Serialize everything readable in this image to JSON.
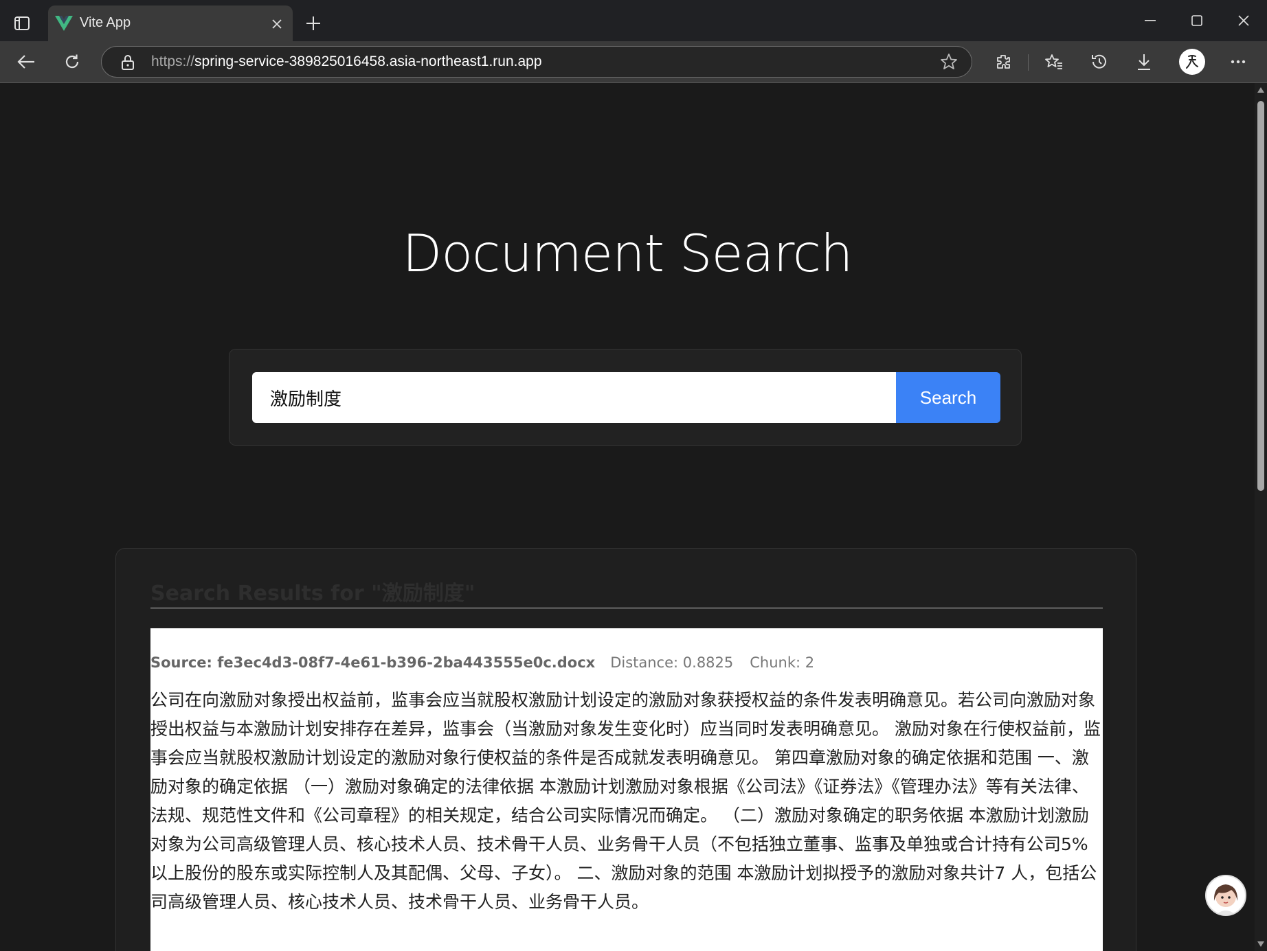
{
  "browser": {
    "tab_title": "Vite App",
    "url_protocol": "https://",
    "url_host": "spring-service-389825016458.asia-northeast1.run.app"
  },
  "page": {
    "title": "Document Search",
    "search": {
      "query": "激励制度",
      "button_label": "Search"
    },
    "results": {
      "heading": "Search Results for \"激励制度\"",
      "items": [
        {
          "source": "Source: fe3ec4d3-08f7-4e61-b396-2ba443555e0c.docx",
          "distance": "Distance: 0.8825",
          "chunk": "Chunk: 2",
          "text": "公司在向激励对象授出权益前，监事会应当就股权激励计划设定的激励对象获授权益的条件发表明确意见。若公司向激励对象授出权益与本激励计划安排存在差异，监事会（当激励对象发生变化时）应当同时发表明确意见。 激励对象在行使权益前，监事会应当就股权激励计划设定的激励对象行使权益的条件是否成就发表明确意见。 第四章激励对象的确定依据和范围 一、激励对象的确定依据 （一）激励对象确定的法律依据 本激励计划激励对象根据《公司法》《证券法》《管理办法》等有关法律、法规、规范性文件和《公司章程》的相关规定，结合公司实际情况而确定。 （二）激励对象确定的职务依据 本激励计划激励对象为公司高级管理人员、核心技术人员、技术骨干人员、业务骨干人员（不包括独立董事、监事及单独或合计持有公司5%以上股份的股东或实际控制人及其配偶、父母、子女）。 二、激励对象的范围 本激励计划拟授予的激励对象共计7 人，包括公司高级管理人员、核心技术人员、技术骨干人员、业务骨干人员。"
        }
      ]
    }
  },
  "colors": {
    "accent": "#3b82f6",
    "background": "#1a1a1a",
    "card": "#222222",
    "vue_green": "#41b883"
  }
}
